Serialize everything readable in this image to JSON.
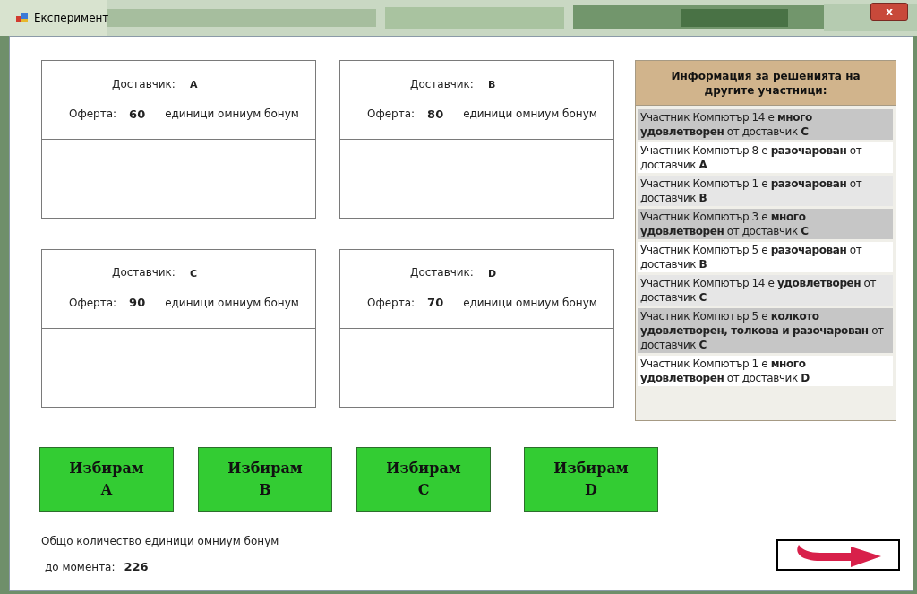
{
  "window": {
    "title": "Експеримент",
    "close": "x"
  },
  "offers": [
    {
      "supplier_label": "Доставчик:",
      "supplier": "A",
      "offer_label": "Оферта:",
      "amount": "60",
      "unit": "единици омниум бонум"
    },
    {
      "supplier_label": "Доставчик:",
      "supplier": "B",
      "offer_label": "Оферта:",
      "amount": "80",
      "unit": "единици омниум бонум"
    },
    {
      "supplier_label": "Доставчик:",
      "supplier": "C",
      "offer_label": "Оферта:",
      "amount": "90",
      "unit": "единици омниум бонум"
    },
    {
      "supplier_label": "Доставчик:",
      "supplier": "D",
      "offer_label": "Оферта:",
      "amount": "70",
      "unit": "единици омниум бонум"
    }
  ],
  "info_panel": {
    "title": "Информация за решенията на другите участници:",
    "items": [
      {
        "text": "Участник Компютър 14 е **много удовлетворен** от доставчик **C**",
        "color": "#c6c6c6"
      },
      {
        "text": "Участник Компютър 8 е **разочарован** от доставчик **A**",
        "color": "#ffffff"
      },
      {
        "text": "Участник Компютър 1 е **разочарован** от доставчик **B**",
        "color": "#e6e6e6"
      },
      {
        "text": "Участник Компютър 3 е **много удовлетворен** от доставчик **C**",
        "color": "#c6c6c6"
      },
      {
        "text": "Участник Компютър 5 е **разочарован** от доставчик **B**",
        "color": "#ffffff"
      },
      {
        "text": "Участник Компютър 14 е **удовлетворен** от доставчик **C**",
        "color": "#e6e6e6"
      },
      {
        "text": "Участник Компютър 5 е **колкото удовлетворен, толкова и разочарован** от доставчик **C**",
        "color": "#c6c6c6"
      },
      {
        "text": "Участник Компютър 1 е **много удовлетворен** от доставчик **D**",
        "color": "#ffffff"
      }
    ]
  },
  "choice_buttons": [
    {
      "line1": "Избирам",
      "line2": "A"
    },
    {
      "line1": "Избирам",
      "line2": "B"
    },
    {
      "line1": "Избирам",
      "line2": "C"
    },
    {
      "line1": "Избирам",
      "line2": "D"
    }
  ],
  "total": {
    "label_line1": "Общо количество единици омниум бонум",
    "label_line2": "до момента:",
    "value": "226"
  }
}
